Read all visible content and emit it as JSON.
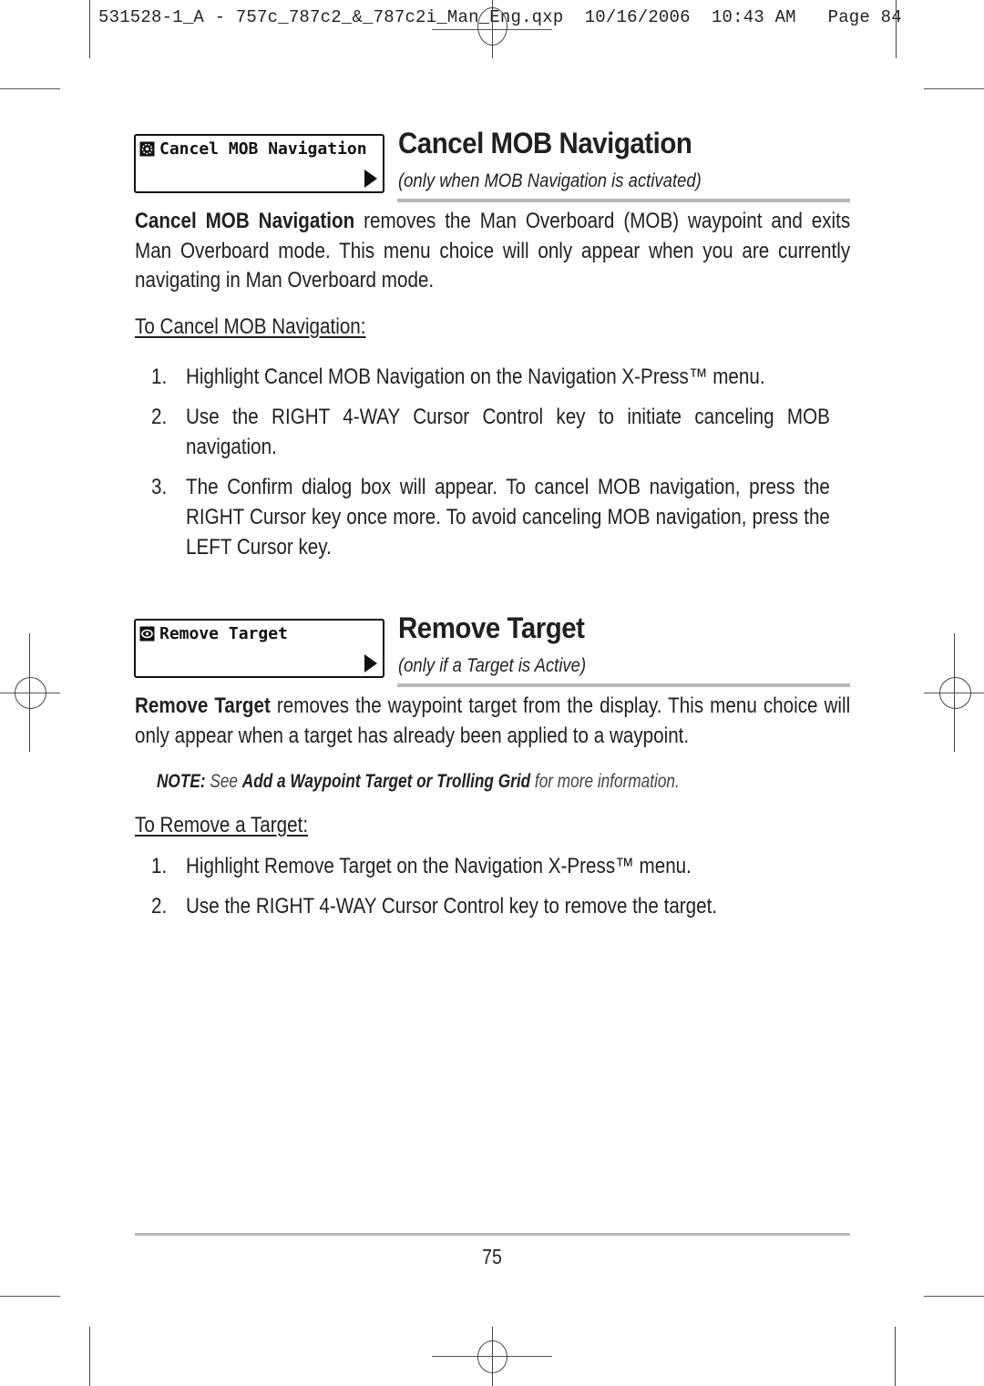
{
  "slug": {
    "filename": "531528-1_A - 757c_787c2_&_787c2i_Man_Eng.qxp",
    "date": "10/16/2006",
    "time": "10:43 AM",
    "page": "Page 84"
  },
  "sections": [
    {
      "menu_label": "Cancel MOB Navigation",
      "menu_icon": "mob-icon",
      "title": "Cancel MOB Navigation",
      "subtitle": "(only when MOB Navigation is activated)",
      "body_bold": "Cancel MOB Navigation",
      "body_text": " removes the Man Overboard (MOB) waypoint and exits Man Overboard mode. This menu choice will only appear when you are currently navigating in Man Overboard mode.",
      "procedure_heading": "To Cancel MOB Navigation:",
      "steps": [
        {
          "num": "1.",
          "text": "Highlight Cancel MOB Navigation on the Navigation X-Press™ menu."
        },
        {
          "num": "2.",
          "text": "Use the RIGHT 4-WAY Cursor Control key to initiate canceling MOB navigation."
        },
        {
          "num": "3.",
          "text": "The Confirm dialog box will appear. To cancel MOB navigation, press the RIGHT Cursor key once more. To avoid canceling MOB navigation, press the LEFT Cursor key."
        }
      ]
    },
    {
      "menu_label": "Remove Target",
      "menu_icon": "target-icon",
      "title": "Remove Target",
      "subtitle": "(only if a Target is Active)",
      "body_bold": "Remove Target",
      "body_text": " removes the waypoint target from the display. This menu choice will only appear when a target has already been applied to a waypoint.",
      "note": {
        "label": "NOTE:",
        "pre": " See ",
        "ref": "Add a Waypoint Target or Trolling Grid",
        "post": " for more information."
      },
      "procedure_heading": "To Remove a Target:",
      "steps": [
        {
          "num": "1.",
          "text": "Highlight Remove Target on the Navigation X-Press™ menu."
        },
        {
          "num": "2.",
          "text": "Use the RIGHT 4-WAY Cursor Control key to remove the target."
        }
      ]
    }
  ],
  "footer": {
    "page_number": "75"
  }
}
